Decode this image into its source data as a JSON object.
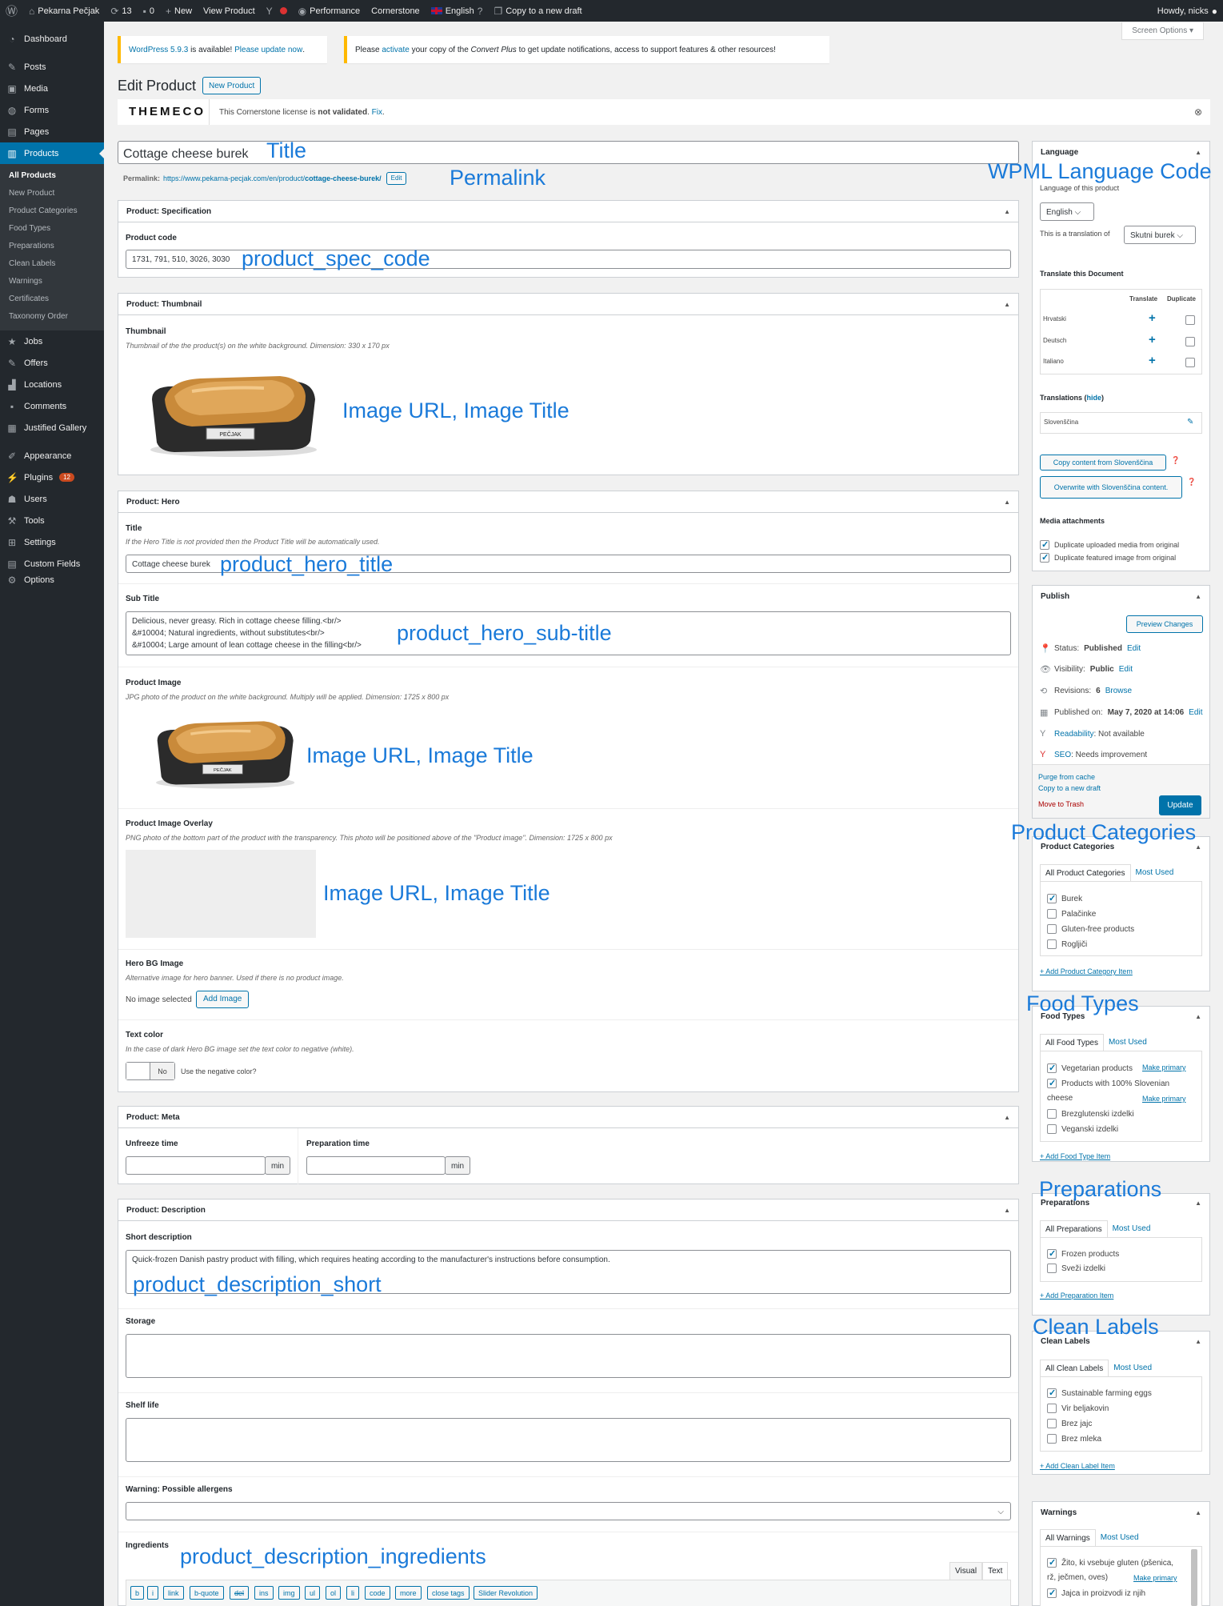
{
  "adminbar": {
    "site_name": "Pekarna Pečjak",
    "updates_count": "13",
    "comments_count": "0",
    "new_label": "New",
    "view_product": "View Product",
    "performance": "Performance",
    "cornerstone": "Cornerstone",
    "language": "English",
    "copy_draft": "Copy to a new draft",
    "howdy": "Howdy, nicks"
  },
  "menu": {
    "dashboard": "Dashboard",
    "posts": "Posts",
    "media": "Media",
    "forms": "Forms",
    "pages": "Pages",
    "products": "Products",
    "sub": [
      "All Products",
      "New Product",
      "Product Categories",
      "Food Types",
      "Preparations",
      "Clean Labels",
      "Warnings",
      "Certificates",
      "Taxonomy Order"
    ],
    "jobs": "Jobs",
    "offers": "Offers",
    "locations": "Locations",
    "comments": "Comments",
    "justified_gallery": "Justified Gallery",
    "appearance": "Appearance",
    "plugins": "Plugins",
    "plugins_badge": "12",
    "users": "Users",
    "tools": "Tools",
    "settings": "Settings",
    "custom_fields": "Custom Fields",
    "options": "Options"
  },
  "notices": {
    "wp_version_link": "WordPress 5.9.3",
    "wp_middle": " is available! ",
    "wp_update_link": "Please update now",
    "wp_end": ".",
    "cp_start": "Please ",
    "cp_link": "activate",
    "cp_mid": " your copy of the ",
    "cp_name": "Convert Plus",
    "cp_end": " to get update notifications, access to support features & other resources!"
  },
  "screen_options": "Screen Options ▾",
  "page_title": "Edit Product",
  "new_product_button": "New Product",
  "themeco": {
    "logo": "THEMECO",
    "text_start": "This Cornerstone license is ",
    "text_bold": "not validated",
    "text_mid": ". ",
    "fix_link": "Fix",
    "text_end": "."
  },
  "title_field": "Cottage cheese burek",
  "permalink": {
    "label": "Permalink:",
    "url_base": "https://www.pekarna-pecjak.com/en/product/",
    "slug": "cottage-cheese-burek/",
    "edit": "Edit"
  },
  "spec": {
    "header": "Product: Specification",
    "code_label": "Product code",
    "code_value": "1731, 791, 510, 3026, 3030"
  },
  "thumb": {
    "header": "Product: Thumbnail",
    "label": "Thumbnail",
    "hint": "Thumbnail of the the product(s) on the white background. Dimension: 330 x 170 px",
    "brand": "PEČJAK"
  },
  "hero": {
    "header": "Product: Hero",
    "title_label": "Title",
    "title_hint": "If the Hero Title is not provided then the Product Title will be automatically used.",
    "title_value": "Cottage cheese burek",
    "subtitle_label": "Sub Title",
    "subtitle_value": "Delicious, never greasy. Rich in cottage cheese filling.<br/>\n&#10004; Natural ingredients, without substitutes<br/>\n&#10004; Large amount of lean cottage cheese in the filling<br/>",
    "image_label": "Product Image",
    "image_hint": "JPG photo of the product on the white background. Multiply will be applied. Dimension: 1725 x 800 px",
    "overlay_label": "Product Image Overlay",
    "overlay_hint": "PNG photo of the bottom part of the product with the transparency. This photo will be positioned above of the \"Product image\". Dimension: 1725 x 800 px",
    "bg_label": "Hero BG Image",
    "bg_hint": "Alternative image for hero banner. Used if there is no product image.",
    "no_image": "No image selected",
    "add_image": "Add Image",
    "textcolor_label": "Text color",
    "textcolor_hint": "In the case of dark Hero BG image set the text color to negative (white).",
    "toggle_value": "No",
    "toggle_label": "Use the negative color?"
  },
  "meta": {
    "header": "Product: Meta",
    "unfreeze_label": "Unfreeze time",
    "prep_label": "Preparation time",
    "unit": "min"
  },
  "desc": {
    "header": "Product: Description",
    "short_label": "Short description",
    "short_value": "Quick-frozen Danish pastry product with filling, which requires heating according to the manufacturer's instructions before consumption.",
    "storage_label": "Storage",
    "shelf_label": "Shelf life",
    "allergens_label": "Warning: Possible allergens",
    "ingredients_label": "Ingredients",
    "tab_visual": "Visual",
    "tab_text": "Text",
    "quicktags": [
      "b",
      "i",
      "link",
      "b-quote",
      "del",
      "ins",
      "img",
      "ul",
      "ol",
      "li",
      "code",
      "more",
      "close tags",
      "Slider Revolution"
    ]
  },
  "language_box": {
    "header": "Language",
    "of_product": "Language of this product",
    "selected": "English",
    "translation_of": "This is a translation of",
    "translation_value": "Skutni burek",
    "translate_doc": "Translate this Document",
    "col_translate": "Translate",
    "col_duplicate": "Duplicate",
    "langs": [
      "Hrvatski",
      "Deutsch",
      "Italiano"
    ],
    "translations_label": "Translations",
    "hide": "hide",
    "translation_item": "Slovenščina",
    "copy_btn": "Copy content from Slovenščina",
    "overwrite_btn": "Overwrite with Slovenščina content.",
    "media_label": "Media attachments",
    "dup_media": "Duplicate uploaded media from original",
    "dup_featured": "Duplicate featured image from original"
  },
  "publish": {
    "header": "Publish",
    "preview": "Preview Changes",
    "status_label": "Status: ",
    "status_value": "Published",
    "visibility_label": "Visibility: ",
    "visibility_value": "Public",
    "revisions_label": "Revisions: ",
    "revisions_value": "6",
    "browse": "Browse",
    "published_label": "Published on: ",
    "published_value": "May 7, 2020 at 14:06",
    "edit": "Edit",
    "readability_link": "Readability",
    "readability_value": ": Not available",
    "seo_link": "SEO",
    "seo_value": ": Needs improvement",
    "purge": "Purge from cache",
    "copy_draft": "Copy to a new draft",
    "trash": "Move to Trash",
    "update": "Update"
  },
  "categories": {
    "header": "Product Categories",
    "tab_all": "All Product Categories",
    "tab_most": "Most Used",
    "items": [
      {
        "label": "Burek",
        "checked": true
      },
      {
        "label": "Palačinke",
        "checked": false
      },
      {
        "label": "Gluten-free products",
        "checked": false
      },
      {
        "label": "Rogljiči",
        "checked": false
      }
    ],
    "add": "+ Add Product Category Item"
  },
  "food_types": {
    "header": "Food Types",
    "tab_all": "All Food Types",
    "tab_most": "Most Used",
    "item1": "Vegetarian products",
    "item2a": "Products with 100% Slovenian",
    "item2b": "cheese",
    "item3": "Brezglutenski izdelki",
    "item4": "Veganski izdelki",
    "make_primary": "Make primary",
    "add": "+ Add Food Type Item"
  },
  "preparations": {
    "header": "Preparations",
    "tab_all": "All Preparations",
    "tab_most": "Most Used",
    "item1": "Frozen products",
    "item2": "Sveži izdelki",
    "add": "+ Add Preparation Item"
  },
  "clean_labels": {
    "header": "Clean Labels",
    "tab_all": "All Clean Labels",
    "tab_most": "Most Used",
    "item1": "Sustainable farming eggs",
    "item2": "Vir beljakovin",
    "item3": "Brez jajc",
    "item4": "Brez mleka",
    "add": "+ Add Clean Label Item"
  },
  "warnings": {
    "header": "Warnings",
    "tab_all": "All Warnings",
    "tab_most": "Most Used",
    "item1a": "Žito, ki vsebuje gluten (pšenica,",
    "item1b": "rž, ječmen, oves)",
    "make_primary": "Make primary",
    "item2": "Jajca in proizvodi iz njih"
  },
  "annotations": {
    "title": "Title",
    "permalink": "Permalink",
    "spec_code": "product_spec_code",
    "image1": "Image URL, Image Title",
    "hero_title": "product_hero_title",
    "hero_subtitle": "product_hero_sub-title",
    "image2": "Image URL, Image Title",
    "image3": "Image URL, Image Title",
    "desc_short": "product_description_short",
    "desc_ingredients": "product_description_ingredients",
    "wpml": "WPML Language Code",
    "product_categories": "Product Categories",
    "food_types": "Food Types",
    "preparations": "Preparations",
    "clean_labels": "Clean Labels"
  }
}
